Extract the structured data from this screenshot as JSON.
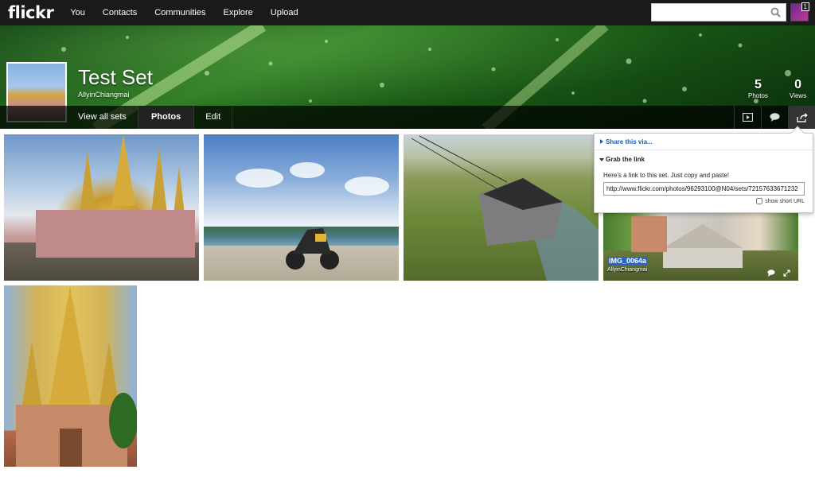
{
  "nav": {
    "logo": "flickr",
    "items": [
      "You",
      "Contacts",
      "Communities",
      "Explore",
      "Upload"
    ],
    "search_placeholder": "",
    "notification_count": "1"
  },
  "set": {
    "title": "Test Set",
    "owner": "AllyinChiangmai",
    "photos_count": "5",
    "photos_label": "Photos",
    "views_count": "0",
    "views_label": "Views"
  },
  "subnav": {
    "view_all_sets": "View all sets",
    "photos": "Photos",
    "edit": "Edit"
  },
  "photos": [
    {
      "title": "",
      "owner": ""
    },
    {
      "title": "",
      "owner": ""
    },
    {
      "title": "",
      "owner": ""
    },
    {
      "title": "IMG_0064a",
      "owner": "AllyinChiangmai"
    },
    {
      "title": "",
      "owner": ""
    }
  ],
  "share": {
    "share_via": "Share this via...",
    "grab_link": "Grab the link",
    "description": "Here's a link to this set. Just copy and paste!",
    "link_value": "http://www.flickr.com/photos/96293100@N04/sets/72157633671232",
    "short_url_label": "show short URL"
  },
  "colors": {
    "nav_bg": "#1a1a1a",
    "link_blue": "#1d5fb4",
    "selection_blue": "#2b64c8"
  }
}
